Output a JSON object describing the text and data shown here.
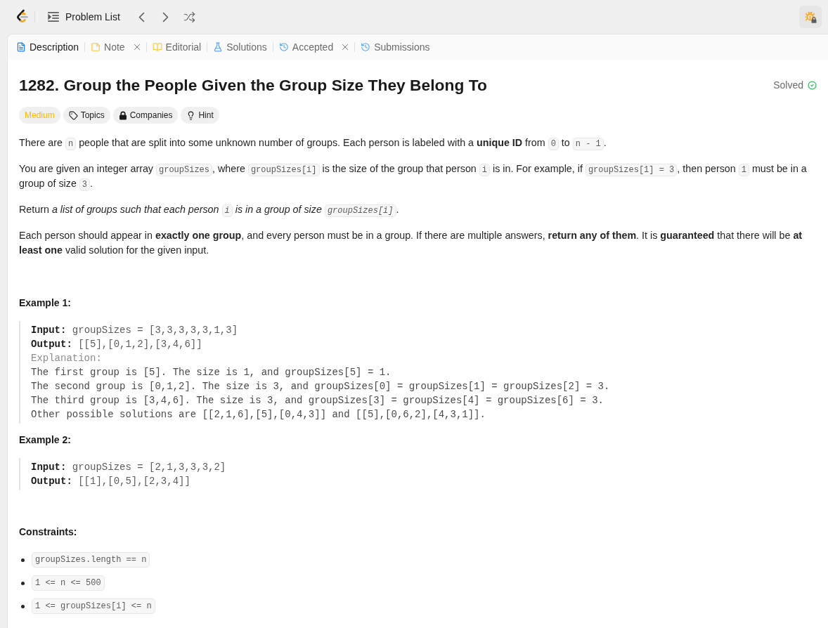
{
  "top_bar": {
    "title": "Problem List"
  },
  "tabs": [
    {
      "label": "Description",
      "selected": true,
      "closable": false
    },
    {
      "label": "Note",
      "selected": false,
      "closable": true
    },
    {
      "label": "Editorial",
      "selected": false,
      "closable": false
    },
    {
      "label": "Solutions",
      "selected": false,
      "closable": false
    },
    {
      "label": "Accepted",
      "selected": false,
      "closable": true
    },
    {
      "label": "Submissions",
      "selected": false,
      "closable": false
    }
  ],
  "problem": {
    "title": "1282. Group the People Given the Group Size They Belong To",
    "status": "Solved",
    "difficulty": {
      "label": "Medium",
      "kind": "medium"
    },
    "chips": [
      "Topics",
      "Companies",
      "Hint"
    ],
    "paragraphs": [
      [
        {
          "kind": "text",
          "text": "There are "
        },
        {
          "kind": "code",
          "text": "n"
        },
        {
          "kind": "text",
          "text": " people that are split into some unknown number of groups. Each person is labeled with a **unique ID** from "
        },
        {
          "kind": "code",
          "text": "0"
        },
        {
          "kind": "text",
          "text": " to "
        },
        {
          "kind": "code",
          "text": "n - 1"
        },
        {
          "kind": "text",
          "text": "."
        }
      ],
      [
        {
          "kind": "text",
          "text": "You are given an integer array "
        },
        {
          "kind": "code",
          "text": "groupSizes"
        },
        {
          "kind": "text",
          "text": ", where "
        },
        {
          "kind": "code",
          "text": "groupSizes[i]"
        },
        {
          "kind": "text",
          "text": " is the size of the group that person "
        },
        {
          "kind": "code",
          "text": "i"
        },
        {
          "kind": "text",
          "text": " is in. For example, if "
        },
        {
          "kind": "code",
          "text": "groupSizes[1] = 3"
        },
        {
          "kind": "text",
          "text": ", then person "
        },
        {
          "kind": "code",
          "text": "1"
        },
        {
          "kind": "text",
          "text": " must be in a group of size "
        },
        {
          "kind": "code",
          "text": "3"
        },
        {
          "kind": "text",
          "text": "."
        }
      ],
      [
        {
          "kind": "text",
          "text": "Return *a list of groups such that each person* "
        },
        {
          "kind": "code_em",
          "text": "i"
        },
        {
          "kind": "text",
          "text": " *is in a group of size* "
        },
        {
          "kind": "code_em",
          "text": "groupSizes[i]"
        },
        {
          "kind": "text",
          "text": "."
        }
      ],
      [
        {
          "kind": "text",
          "text": "Each person should appear in **exactly one group**, and every person must be in a group. If there are multiple answers, **return any of them**. It is **guaranteed** that there will be **at least one** valid solution for the given input."
        }
      ]
    ],
    "examples": [
      {
        "title": "Example 1:",
        "lines": [
          {
            "kind": "field",
            "label": "Input:",
            "value": "groupSizes = [3,3,3,3,3,1,3]"
          },
          {
            "kind": "field",
            "label": "Output:",
            "value": "[[5],[0,1,2],[3,4,6]]"
          },
          {
            "kind": "note",
            "text": "Explanation:"
          },
          {
            "kind": "plain",
            "text": "The first group is [5]. The size is 1, and groupSizes[5] = 1."
          },
          {
            "kind": "plain",
            "text": "The second group is [0,1,2]. The size is 3, and groupSizes[0] = groupSizes[1] = groupSizes[2] = 3."
          },
          {
            "kind": "plain",
            "text": "The third group is [3,4,6]. The size is 3, and groupSizes[3] = groupSizes[4] = groupSizes[6] = 3."
          },
          {
            "kind": "plain",
            "text": "Other possible solutions are [[2,1,6],[5],[0,4,3]] and [[5],[0,6,2],[4,3,1]]."
          }
        ]
      },
      {
        "title": "Example 2:",
        "lines": [
          {
            "kind": "field",
            "label": "Input:",
            "value": "groupSizes = [2,1,3,3,3,2]"
          },
          {
            "kind": "field",
            "label": "Output:",
            "value": "[[1],[0,5],[2,3,4]]"
          }
        ]
      }
    ],
    "constraints_title": "Constraints:",
    "constraints": [
      "groupSizes.length == n",
      "1 <= n <= 500",
      "1 <= groupSizes[i] <= n"
    ]
  }
}
